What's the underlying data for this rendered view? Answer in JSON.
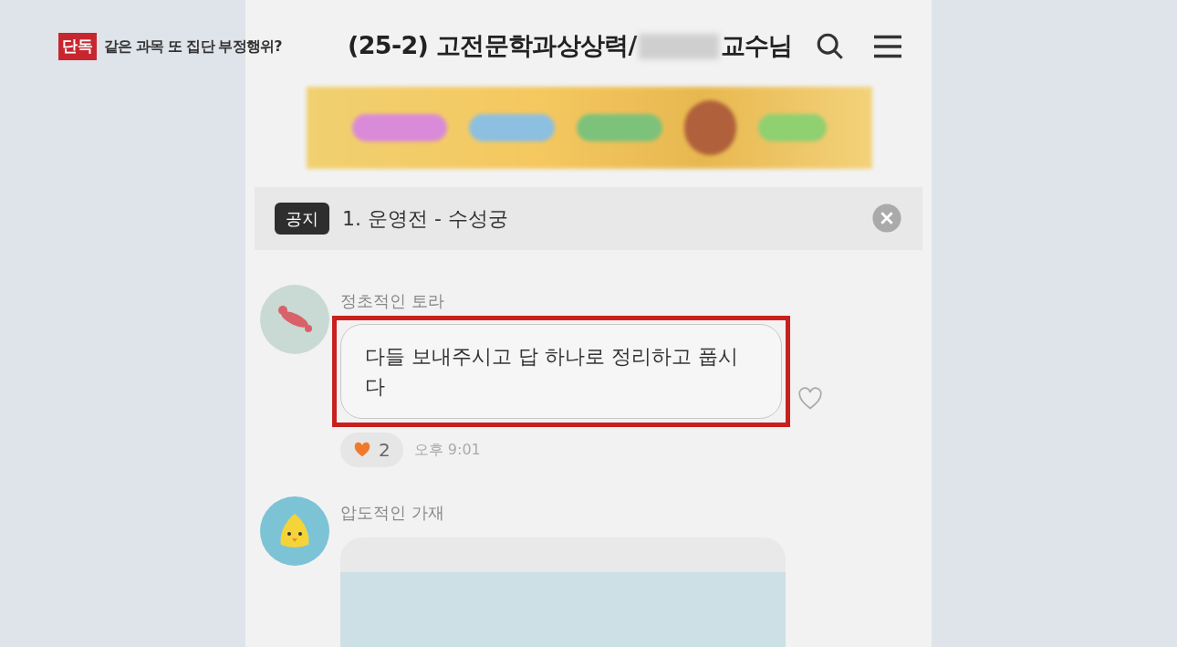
{
  "news_caption": {
    "badge": "단독",
    "headline": "같은 과목 또 집단 부정행위?"
  },
  "chat": {
    "title_start": "(25-2) 고전문학과상상력/",
    "title_end": "교수님"
  },
  "notice": {
    "badge": "공지",
    "text": "1. 운영전 - 수성궁"
  },
  "messages": [
    {
      "sender": "정초적인 토라",
      "kind": "text",
      "text": "다들 보내주시고 답 하나로 정리하고 풉시다",
      "highlighted": true,
      "reaction_count": "2",
      "time": "오후 9:01"
    },
    {
      "sender": "압도적인 가재",
      "kind": "card"
    }
  ]
}
